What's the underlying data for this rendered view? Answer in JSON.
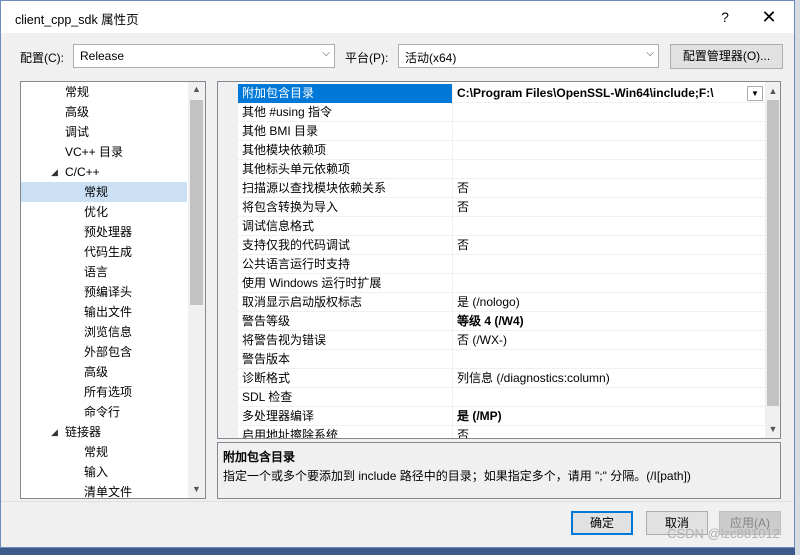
{
  "window": {
    "title": "client_cpp_sdk 属性页",
    "help": "?",
    "close": "✕"
  },
  "config": {
    "label": "配置(C):",
    "value": "Release",
    "platform_label": "平台(P):",
    "platform_value": "活动(x64)",
    "manager_button": "配置管理器(O)..."
  },
  "tree": {
    "items": [
      {
        "label": "常规"
      },
      {
        "label": "高级"
      },
      {
        "label": "调试"
      },
      {
        "label": "VC++ 目录"
      },
      {
        "label": "C/C++"
      },
      {
        "label": "常规"
      },
      {
        "label": "优化"
      },
      {
        "label": "预处理器"
      },
      {
        "label": "代码生成"
      },
      {
        "label": "语言"
      },
      {
        "label": "预编译头"
      },
      {
        "label": "输出文件"
      },
      {
        "label": "浏览信息"
      },
      {
        "label": "外部包含"
      },
      {
        "label": "高级"
      },
      {
        "label": "所有选项"
      },
      {
        "label": "命令行"
      },
      {
        "label": "链接器"
      },
      {
        "label": "常规"
      },
      {
        "label": "输入"
      },
      {
        "label": "清单文件"
      }
    ]
  },
  "grid": {
    "rows": [
      {
        "name": "附加包含目录",
        "value": "C:\\Program Files\\OpenSSL-Win64\\include;F:\\"
      },
      {
        "name": "其他 #using 指令",
        "value": ""
      },
      {
        "name": "其他 BMI 目录",
        "value": ""
      },
      {
        "name": "其他模块依赖项",
        "value": ""
      },
      {
        "name": "其他标头单元依赖项",
        "value": ""
      },
      {
        "name": "扫描源以查找模块依赖关系",
        "value": "否"
      },
      {
        "name": "将包含转换为导入",
        "value": "否"
      },
      {
        "name": "调试信息格式",
        "value": ""
      },
      {
        "name": "支持仅我的代码调试",
        "value": "否"
      },
      {
        "name": "公共语言运行时支持",
        "value": ""
      },
      {
        "name": "使用 Windows 运行时扩展",
        "value": ""
      },
      {
        "name": "取消显示启动版权标志",
        "value": "是 (/nologo)"
      },
      {
        "name": "警告等级",
        "value": "等级 4 (/W4)"
      },
      {
        "name": "将警告视为错误",
        "value": "否 (/WX-)"
      },
      {
        "name": "警告版本",
        "value": ""
      },
      {
        "name": "诊断格式",
        "value": "列信息 (/diagnostics:column)"
      },
      {
        "name": "SDL 检查",
        "value": ""
      },
      {
        "name": "多处理器编译",
        "value": "是 (/MP)"
      },
      {
        "name": "启用地址擦除系统",
        "value": "否"
      }
    ]
  },
  "description": {
    "title": "附加包含目录",
    "text": "指定一个或多个要添加到 include 路径中的目录；如果指定多个，请用 \";\" 分隔。(/I[path])"
  },
  "buttons": {
    "ok": "确定",
    "cancel": "取消",
    "apply": "应用(A)"
  },
  "watermark": "CSDN @lzc881012"
}
